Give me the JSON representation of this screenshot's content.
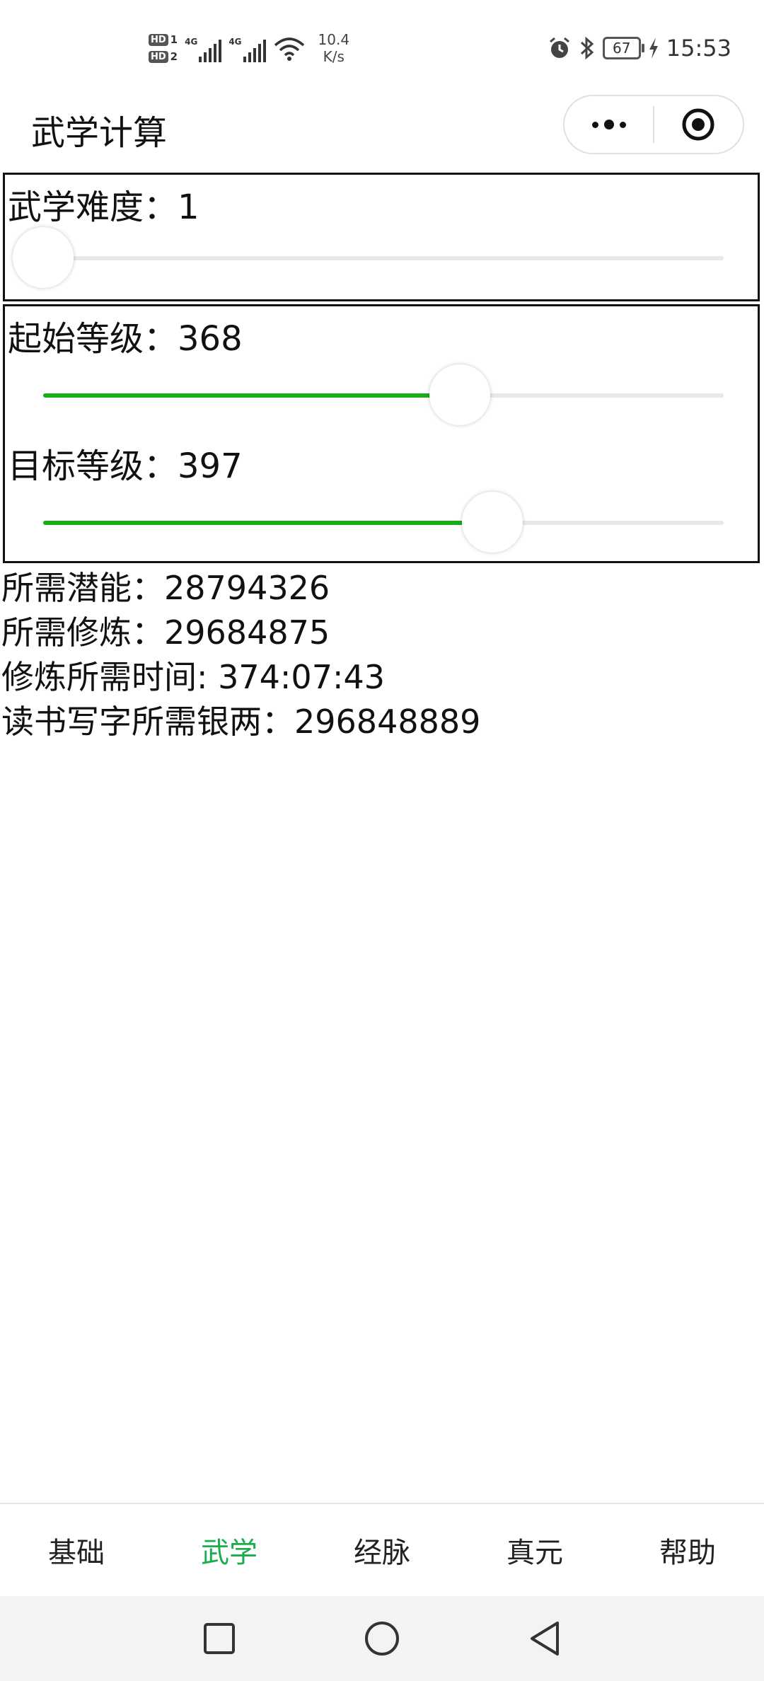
{
  "status_bar": {
    "sim1": "HD",
    "sim1_index": "1",
    "sim2": "HD",
    "sim2_index": "2",
    "network1": "4G",
    "network2": "4G",
    "speed_value": "10.4",
    "speed_unit": "K/s",
    "battery": "67",
    "time": "15:53",
    "icons": [
      "alarm-icon",
      "bluetooth-icon",
      "battery-icon",
      "charging-icon",
      "wifi-icon",
      "signal-icon"
    ]
  },
  "nav": {
    "title": "武学计算"
  },
  "difficulty": {
    "label": "武学难度：",
    "value": "1",
    "slider_fraction": 0.0
  },
  "start_level": {
    "label": "起始等级：",
    "value": "368",
    "slider_fraction": 0.612
  },
  "target_level": {
    "label": "目标等级：",
    "value": "397",
    "slider_fraction": 0.66
  },
  "results": {
    "potential_label": "所需潜能：",
    "potential_value": "28794326",
    "cultivation_label": "所需修炼：",
    "cultivation_value": "29684875",
    "time_label": "修炼所需时间: ",
    "time_value": "374:07:43",
    "silver_label": "读书写字所需银两：",
    "silver_value": "296848889"
  },
  "tabs": [
    {
      "label": "基础",
      "active": false
    },
    {
      "label": "武学",
      "active": true
    },
    {
      "label": "经脉",
      "active": false
    },
    {
      "label": "真元",
      "active": false
    },
    {
      "label": "帮助",
      "active": false
    }
  ],
  "colors": {
    "accent_green": "#1aad19",
    "tab_active": "#1aad4c",
    "track": "#e8e8e8"
  }
}
